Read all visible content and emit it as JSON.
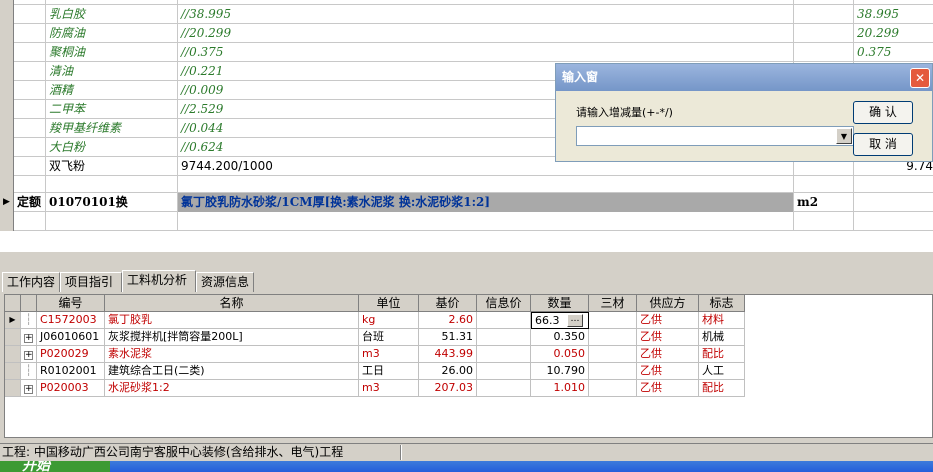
{
  "top_grid": {
    "rows": [
      {
        "c2": "",
        "c3": "",
        "c5": "",
        "style": "sub"
      },
      {
        "c2": "乳白胶",
        "c3": "//38.995",
        "c5": "38.995",
        "style": "sub"
      },
      {
        "c2": "防腐油",
        "c3": "//20.299",
        "c5": "20.299",
        "style": "sub"
      },
      {
        "c2": "聚桐油",
        "c3": "//0.375",
        "c5": "0.375",
        "style": "sub"
      },
      {
        "c2": "清油",
        "c3": "//0.221",
        "c5": "",
        "style": "sub"
      },
      {
        "c2": "酒精",
        "c3": "//0.009",
        "c5": "",
        "style": "sub"
      },
      {
        "c2": "二甲苯",
        "c3": "//2.529",
        "c5": "",
        "style": "sub"
      },
      {
        "c2": "羧甲基纤维素",
        "c3": "//0.044",
        "c5": "",
        "style": "sub"
      },
      {
        "c2": "大白粉",
        "c3": "//0.624",
        "c5": "",
        "style": "sub"
      },
      {
        "c2": "双飞粉",
        "c3": "9744.200/1000",
        "c5": "9.74",
        "style": "normal"
      },
      {
        "c2": "",
        "c3": "",
        "c5": "",
        "style": "normal"
      },
      {
        "c1": "定额",
        "c2": "01070101换",
        "c3": "氯丁胶乳防水砂浆/1CM厚[换:素水泥浆 换:水泥砂浆1:2]",
        "c4": "m2",
        "c5": "",
        "style": "quota"
      },
      {
        "c2": "",
        "c3": "",
        "c5": "",
        "style": "normal"
      }
    ]
  },
  "dialog": {
    "title": "输入窗",
    "label": "请输入增减量(+-*/)",
    "input_value": "",
    "ok": "确 认",
    "cancel": "取 消"
  },
  "tabs": [
    "工作内容",
    "项目指引",
    "工料机分析",
    "资源信息"
  ],
  "active_tab": 2,
  "bottom_grid": {
    "headers": [
      "编号",
      "名称",
      "单位",
      "基价",
      "信息价",
      "数量",
      "三材",
      "供应方",
      "标志"
    ],
    "rows": [
      {
        "code": "C1572003",
        "name": "氯丁胶乳",
        "unit": "kg",
        "price": "2.60",
        "info": "",
        "qty": "66.3",
        "sancai": "",
        "supplier": "乙供",
        "flag": "材料",
        "red": true,
        "current": true,
        "expand": false
      },
      {
        "code": "J06010601",
        "name": "灰浆搅拌机[拌筒容量200L]",
        "unit": "台班",
        "price": "51.31",
        "info": "",
        "qty": "0.350",
        "sancai": "",
        "supplier": "乙供",
        "flag": "机械",
        "red": false,
        "current": false,
        "expand": true
      },
      {
        "code": "P020029",
        "name": "素水泥浆",
        "unit": "m3",
        "price": "443.99",
        "info": "",
        "qty": "0.050",
        "sancai": "",
        "supplier": "乙供",
        "flag": "配比",
        "red": true,
        "current": false,
        "expand": true
      },
      {
        "code": "R0102001",
        "name": "建筑综合工日(二类)",
        "unit": "工日",
        "price": "26.00",
        "info": "",
        "qty": "10.790",
        "sancai": "",
        "supplier": "乙供",
        "flag": "人工",
        "red": false,
        "current": false,
        "expand": false
      },
      {
        "code": "P020003",
        "name": "水泥砂浆1:2",
        "unit": "m3",
        "price": "207.03",
        "info": "",
        "qty": "1.010",
        "sancai": "",
        "supplier": "乙供",
        "flag": "配比",
        "red": true,
        "current": false,
        "expand": true
      }
    ]
  },
  "status": {
    "project": "工程: 中国移动广西公司南宁客服中心装修(含给排水、电气)工程"
  },
  "taskbar": {
    "start": "开始"
  }
}
